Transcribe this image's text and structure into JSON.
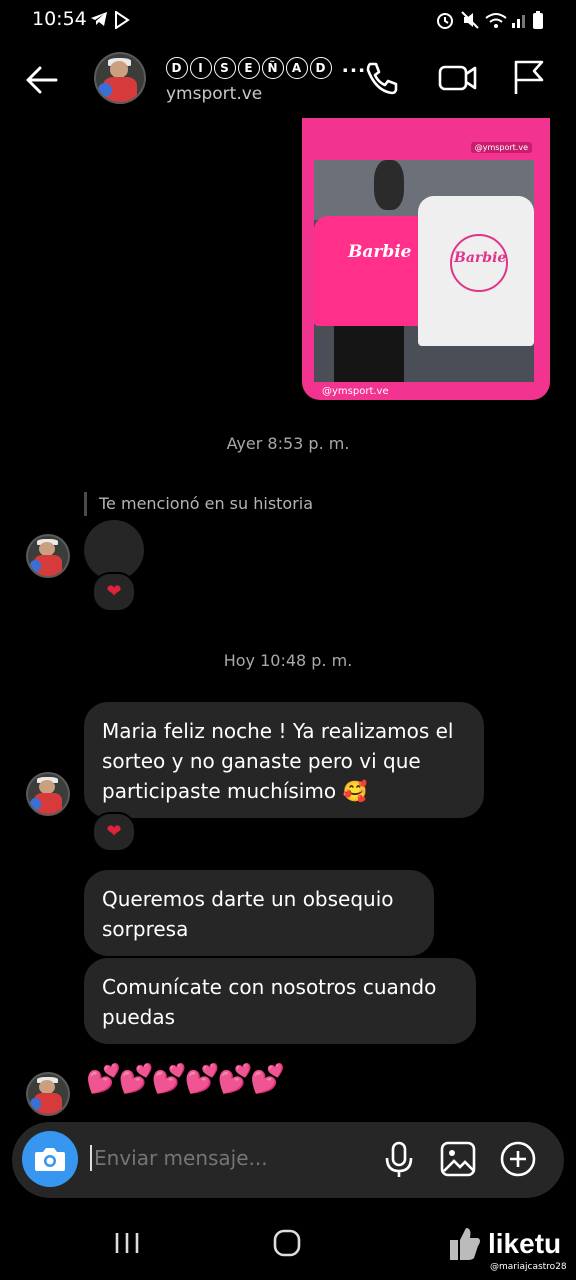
{
  "status_bar": {
    "time": "10:54"
  },
  "header": {
    "name_letters": [
      "D",
      "I",
      "S",
      "E",
      "Ñ",
      "A",
      "D"
    ],
    "name_suffix": "...",
    "handle": "ymsport.ve"
  },
  "story": {
    "tag": "@ymsport.ve",
    "user": "@ymsport.ve",
    "shirt_text": "Barbie",
    "shirt_text_2": "Barbie"
  },
  "thread": {
    "date_1": "Ayer 8:53 p. m.",
    "mention": "Te mencionó en su historia",
    "date_2": "Hoy 10:48 p. m.",
    "messages": [
      "Maria feliz noche ! Ya realizamos el sorteo y no ganaste pero vi que participaste muchísimo 🥰",
      "Queremos darte un obsequio sorpresa",
      "Comunícate con nosotros cuando puedas"
    ],
    "reaction": "❤",
    "hearts": "💕💕💕💕💕💕"
  },
  "composer": {
    "placeholder": "Enviar mensaje..."
  },
  "watermark": {
    "brand": "liketu",
    "handle": "@mariajcastro28"
  },
  "colors": {
    "accent": "#3797f0",
    "bubble": "#262626",
    "story_pink": "#f2338f"
  }
}
